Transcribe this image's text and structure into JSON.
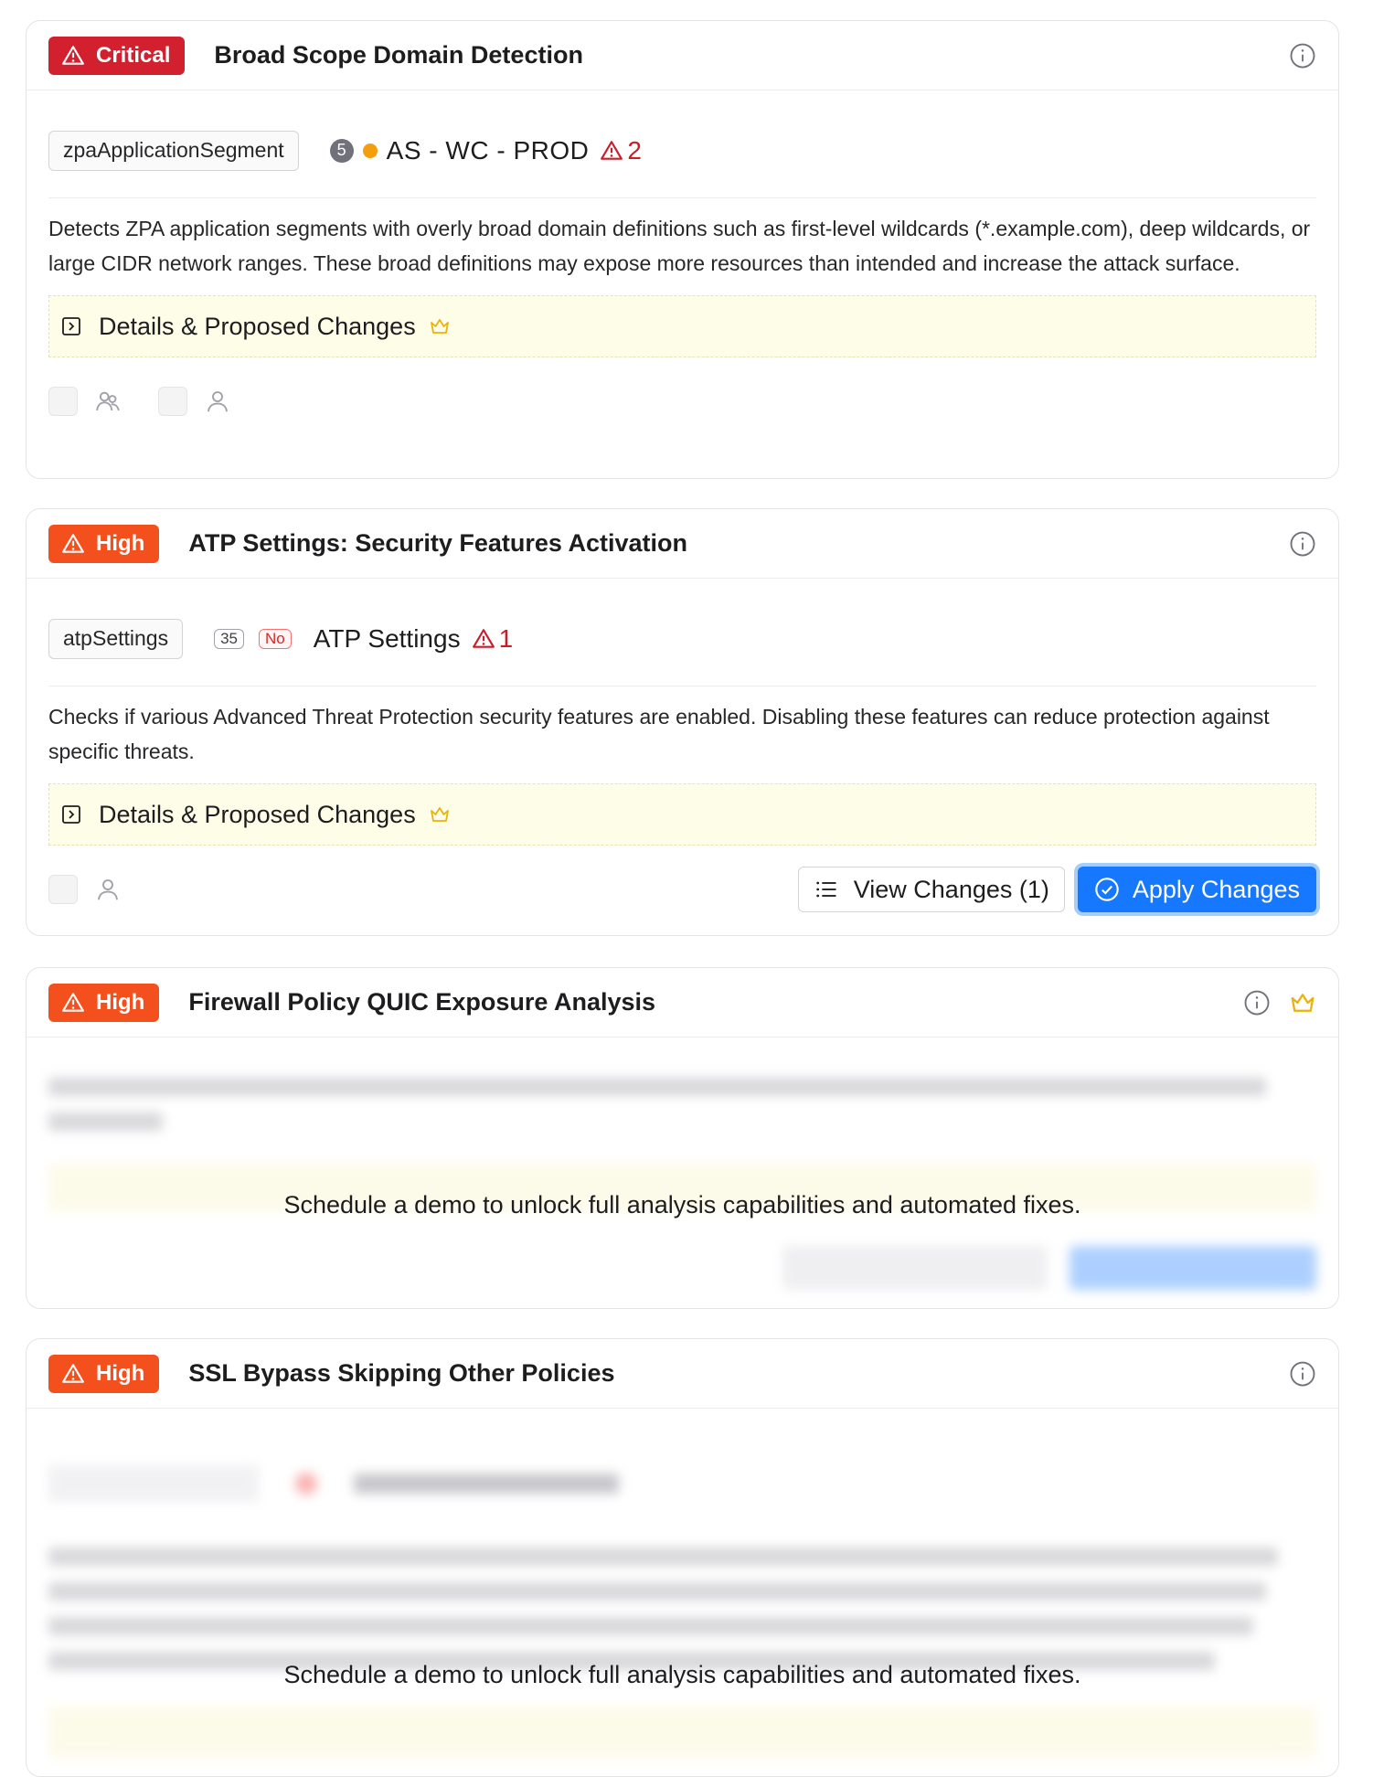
{
  "cards": [
    {
      "severity": "Critical",
      "title": "Broad Scope Domain Detection",
      "resource_type": "zpaApplicationSegment",
      "count": "5",
      "environment": "AS - WC - PROD",
      "warning_count": "2",
      "description": "Detects ZPA application segments with overly broad domain definitions such as first-level wildcards (*.example.com), deep wildcards, or large CIDR network ranges. These broad definitions may expose more resources than intended and increase the attack surface.",
      "details_label": "Details & Proposed Changes"
    },
    {
      "severity": "High",
      "title": "ATP Settings: Security Features Activation",
      "resource_type": "atpSettings",
      "count": "35",
      "enabled_badge": "No",
      "object_name": "ATP Settings",
      "warning_count": "1",
      "description": "Checks if various Advanced Threat Protection security features are enabled. Disabling these features can reduce protection against specific threats.",
      "details_label": "Details & Proposed Changes",
      "view_changes_label": "View Changes (1)",
      "apply_changes_label": "Apply Changes"
    },
    {
      "severity": "High",
      "title": "Firewall Policy QUIC Exposure Analysis",
      "locked_message": "Schedule a demo to unlock full analysis capabilities and automated fixes."
    },
    {
      "severity": "High",
      "title": "SSL Bypass Skipping Other Policies",
      "locked_message": "Schedule a demo to unlock full analysis capabilities and automated fixes."
    }
  ],
  "colors": {
    "critical": "#d3202e",
    "high": "#f4501e",
    "primary": "#1677ff",
    "warning": "#c81e2a",
    "status_dot": "#f59e0b",
    "details_bg": "#fefde8"
  },
  "icons": {
    "severity": "warning-triangle-icon",
    "info": "info-circle-icon",
    "premium": "crown-icon",
    "expand": "expand-square-icon",
    "assign_group": "user-group-icon",
    "assign_user": "user-icon",
    "list": "list-icon",
    "apply": "check-circle-icon"
  }
}
